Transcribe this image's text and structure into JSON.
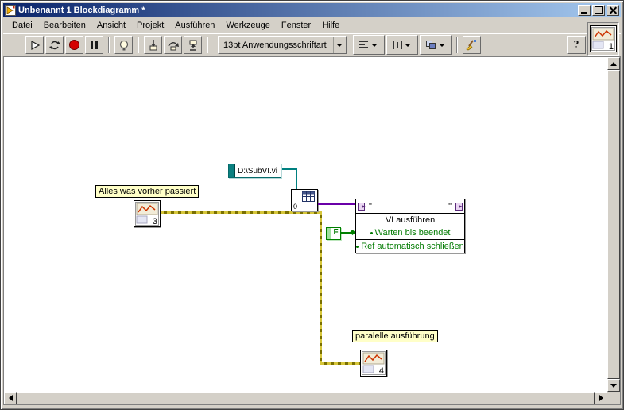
{
  "window": {
    "title": "Unbenannt 1 Blockdiagramm *"
  },
  "menu": {
    "items": [
      {
        "label": "Datei",
        "accel": 0
      },
      {
        "label": "Bearbeiten",
        "accel": 0
      },
      {
        "label": "Ansicht",
        "accel": 0
      },
      {
        "label": "Projekt",
        "accel": 0
      },
      {
        "label": "Ausführen",
        "accel": 1
      },
      {
        "label": "Werkzeuge",
        "accel": 0
      },
      {
        "label": "Fenster",
        "accel": 0
      },
      {
        "label": "Hilfe",
        "accel": 0
      }
    ]
  },
  "toolbar": {
    "font_selector_label": "13pt Anwendungsschriftart",
    "help_label": "?",
    "panel_icon_number": "1"
  },
  "diagram": {
    "label_before": "Alles was vorher passiert",
    "label_parallel": "paralelle ausführung",
    "vi3_number": "3",
    "vi4_number": "4",
    "path_constant_value": "D:\\SubVI.vi",
    "open_vi_options": "0",
    "bool_constant_value": "F",
    "invoke_node": {
      "quote_left": "\"",
      "quote_right": "\"",
      "method_name": "VI ausführen",
      "param1": "Warten bis beendet",
      "param2": "Ref automatisch schließen"
    }
  },
  "colors": {
    "titlebar_left": "#0a246a",
    "titlebar_right": "#a6caf0",
    "chrome": "#d4d0c8",
    "label_bg": "#ffffc8",
    "error_wire": "#b8a000",
    "path_wire": "#008080",
    "ref_wire": "#6a00a8",
    "bool_wire": "#008000",
    "param_text": "#007a00"
  }
}
